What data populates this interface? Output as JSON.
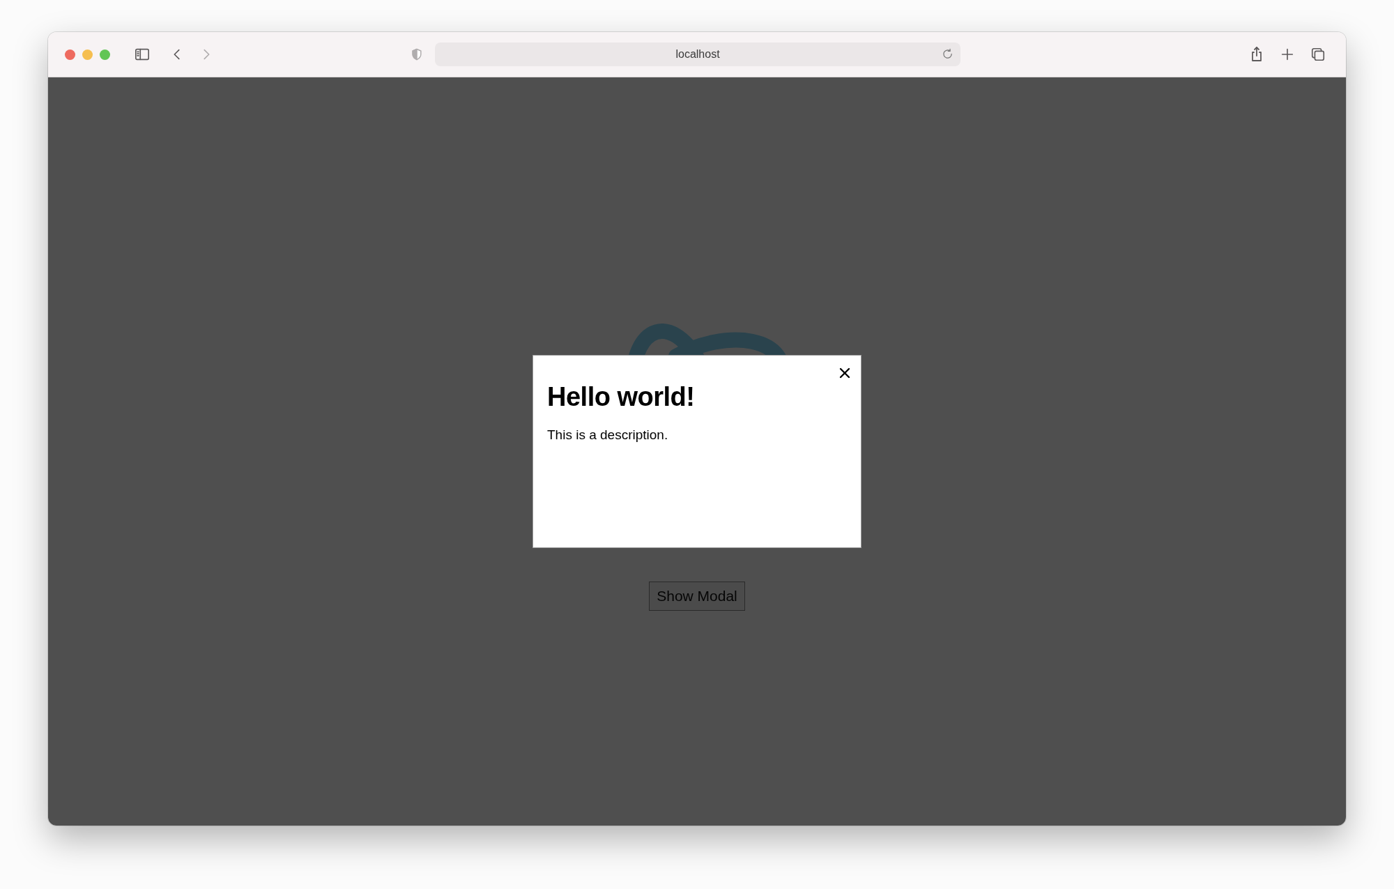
{
  "browser": {
    "url": "localhost"
  },
  "page": {
    "button": "Show Modal"
  },
  "modal": {
    "open": true,
    "title": "Hello world!",
    "description": "This is a description."
  }
}
